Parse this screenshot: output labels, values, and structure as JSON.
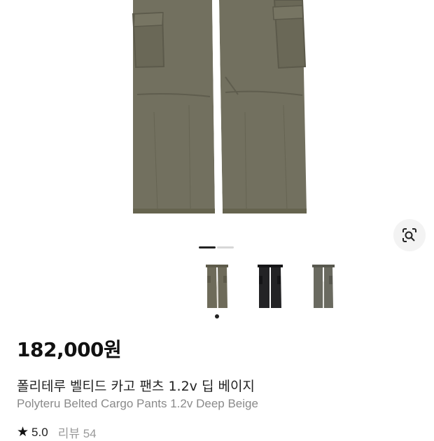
{
  "product": {
    "price": "182,000원",
    "title_ko": "폴리테루 벨티드 카고 팬츠 1.2v 딥 베이지",
    "title_en": "Polyteru Belted Cargo Pants 1.2v Deep Beige",
    "rating": "5.0",
    "review_label": "리뷰 54"
  },
  "gallery": {
    "slide_count": 2,
    "active_slide": 1,
    "thumbnails": [
      {
        "color_name": "deep-beige",
        "color": "#6e6b5a"
      },
      {
        "color_name": "black",
        "color": "#232325"
      },
      {
        "color_name": "gray-khaki",
        "color": "#6a6a60"
      }
    ],
    "selected_thumbnail": 1
  },
  "icons": {
    "lens": "lens-search-icon",
    "star": "star-icon"
  },
  "colors": {
    "pants_main": "#72705f",
    "pants_shadow": "#5f5d4e",
    "text_primary": "#111111",
    "text_secondary": "#8a8a8a"
  }
}
